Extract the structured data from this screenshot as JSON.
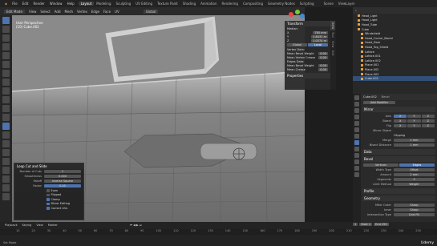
{
  "topbar": {
    "menus": [
      "File",
      "Edit",
      "Render",
      "Window",
      "Help"
    ],
    "tabs": [
      "Layout",
      "Modeling",
      "Sculpting",
      "UV Editing",
      "Texture Paint",
      "Shading",
      "Animation",
      "Rendering",
      "Compositing",
      "Geometry Nodes",
      "Scripting"
    ],
    "active_tab": "Layout",
    "scene": "Scene",
    "view_layer": "ViewLayer"
  },
  "header": {
    "mode": "Edit Mode",
    "menus": [
      "View",
      "Select",
      "Add",
      "Mesh",
      "Vertex",
      "Edge",
      "Face",
      "UV"
    ],
    "transform": "Global"
  },
  "viewport_info": {
    "view": "User Perspective",
    "object": "(10) Cube.002"
  },
  "npanel": {
    "transform_title": "Transform",
    "median_label": "Median:",
    "x_label": "X",
    "x_value": "785 mm",
    "y_label": "Y",
    "y_value": "1.8431 m",
    "z_label": "Z",
    "z_value": "1.0374 m",
    "global_label": "Global",
    "local_label": "Local",
    "vertex_data_title": "Vertex Data:",
    "mean_bevel_label": "Mean Bevel Weight",
    "mean_bevel_value": "0.00",
    "mean_crease_label": "Mean Vertex Crease",
    "mean_crease_value": "0.00",
    "edge_data_title": "Edges Data:",
    "edge_bevel_label": "Mean Bevel Weight",
    "edge_bevel_value": "0.00",
    "edge_crease_label": "Mean Crease",
    "edge_crease_value": "0.00",
    "properties_title": "Properties",
    "tabs": [
      "Item",
      "Tool",
      "View",
      "Edit"
    ]
  },
  "loopcut": {
    "title": "Loop Cut and Slide",
    "cuts_label": "Number of Cuts",
    "cuts_value": "1",
    "smooth_label": "Smoothness",
    "smooth_value": "0.000",
    "falloff_label": "Falloff",
    "falloff_value": "Inverse Square",
    "factor_label": "Factor",
    "factor_value": "0.00",
    "even_label": "Even",
    "flipped_label": "Flipped",
    "clamp_label": "Clamp",
    "mirror_label": "Mirror Editing",
    "uvs_label": "Correct UVs"
  },
  "outliner": {
    "search": "",
    "items": [
      "Head_Light",
      "Hood_Light",
      "Hood_Tube",
      "Cube",
      "Windshield",
      "Hood_Corner_Barrel",
      "Hood_Door",
      "Hood_Top_Shield",
      "Lattice",
      "Lattice.001",
      "Lattice.002",
      "Plane.001",
      "Plane.002",
      "Plane.003",
      "Cube.002"
    ],
    "selected": "Cube.002"
  },
  "props": {
    "object": "Cube.002",
    "modifier": "Bevel",
    "add_modifier": "Add Modifier",
    "mirror_panel": "Mirror",
    "axis_label": "Axis",
    "bisect_label": "Bisect",
    "flip_label": "Flip",
    "axes": [
      "X",
      "Y",
      "Z"
    ],
    "mirror_object_label": "Mirror Object",
    "clipping_label": "Clipping",
    "merge_label": "Merge",
    "merge_value": "1 mm",
    "bisect_dist_label": "Bisect Distance",
    "bisect_dist_value": "1 mm",
    "data_panel": "Data",
    "bevel_panel": "Bevel",
    "vertices_label": "Vertices",
    "edges_label": "Edges",
    "width_type_label": "Width Type",
    "width_type_value": "Offset",
    "amount_label": "Amount",
    "amount_value": "2 mm",
    "segments_label": "Segments",
    "segments_value": "3",
    "limit_label": "Limit Method",
    "limit_value": "Weight",
    "profile_label": "Profile",
    "geometry_label": "Geometry",
    "miter_outer_label": "Miter Outer",
    "miter_outer_value": "Sharp",
    "inner_label": "Inner",
    "inner_value": "Sharp",
    "intersection_label": "Intersection Type",
    "intersection_value": "Grid Fill"
  },
  "timeline": {
    "menus": [
      "Playback",
      "Keying",
      "View",
      "Marker"
    ],
    "current_frame": "1",
    "start_label": "Start",
    "start_value": "1",
    "end_label": "End",
    "end_value": "250",
    "ticks": [
      "10",
      "20",
      "30",
      "40",
      "50",
      "60",
      "70",
      "80",
      "90",
      "100",
      "110",
      "120",
      "130",
      "140",
      "150",
      "160",
      "170",
      "180",
      "190",
      "200",
      "210",
      "220",
      "230",
      "240",
      "250"
    ],
    "status_left": "Set Mode",
    "status_right": "Udemy"
  }
}
